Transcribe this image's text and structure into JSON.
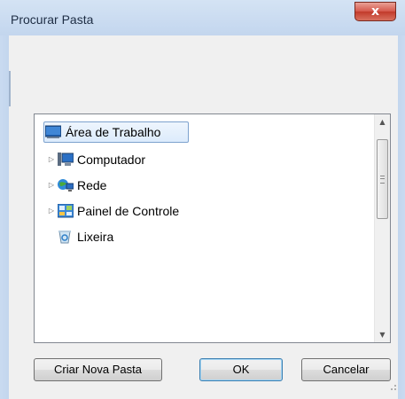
{
  "window": {
    "title": "Procurar Pasta",
    "close_glyph": "x"
  },
  "tree": {
    "items": [
      {
        "label": "Área de Trabalho",
        "icon": "desktop-icon",
        "selected": true,
        "expandable": false
      },
      {
        "label": "Computador",
        "icon": "computer-icon",
        "selected": false,
        "expandable": true
      },
      {
        "label": "Rede",
        "icon": "network-icon",
        "selected": false,
        "expandable": true
      },
      {
        "label": "Painel de Controle",
        "icon": "control-panel-icon",
        "selected": false,
        "expandable": true
      },
      {
        "label": "Lixeira",
        "icon": "recycle-bin-icon",
        "selected": false,
        "expandable": false
      }
    ]
  },
  "buttons": {
    "new_folder": "Criar Nova Pasta",
    "ok": "OK",
    "cancel": "Cancelar"
  },
  "colors": {
    "selection_border": "#7da2ce",
    "title_bar": "#c3d6ee",
    "close_button": "#c23a2a"
  }
}
